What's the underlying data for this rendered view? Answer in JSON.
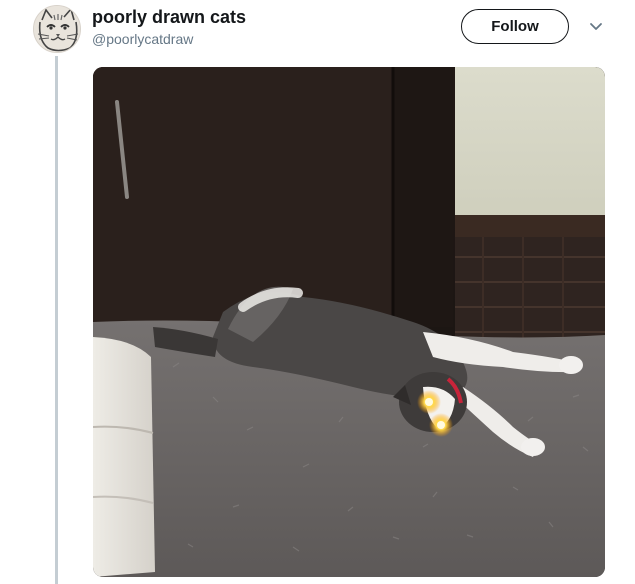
{
  "tweet": {
    "display_name": "poorly drawn cats",
    "handle": "@poorlycatdraw",
    "follow_label": "Follow"
  },
  "icons": {
    "caret": "chevron-down-icon",
    "avatar": "cat-face-avatar"
  },
  "colors": {
    "text_primary": "#14171a",
    "text_secondary": "#657786",
    "thread_line": "#c4cdd3"
  }
}
